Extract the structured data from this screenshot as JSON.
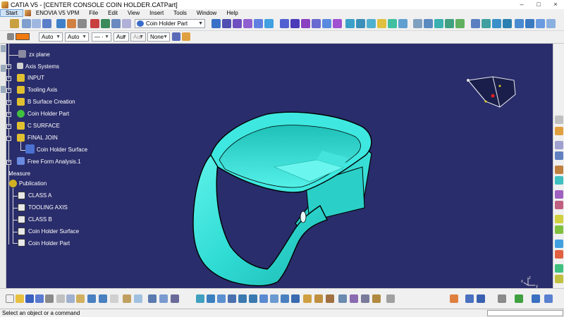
{
  "window": {
    "title": "CATIA V5 - [CENTER CONSOLE COIN HOLDER.CATPart]",
    "controls": [
      "–",
      "□",
      "×"
    ]
  },
  "menu": {
    "items": [
      "Start",
      "ENOVIA V5 VPM",
      "File",
      "Edit",
      "View",
      "Insert",
      "Tools",
      "Window",
      "Help"
    ]
  },
  "toolbar": {
    "current_part": "Coin Holder Part"
  },
  "format_toolbar": {
    "color": "#f07a10",
    "transparency": "Auto",
    "line_thickness": "Auto",
    "line_type": "— · — ·",
    "point_symbol": "Aut",
    "layer_disabled": "Aut",
    "layer": "None"
  },
  "spec_tree": {
    "items": [
      {
        "label": "zx plane",
        "icon": "plane-icon"
      },
      {
        "label": "Axis Systems",
        "icon": "folder-icon"
      },
      {
        "label": "INPUT",
        "icon": "geometrical-set-icon"
      },
      {
        "label": "Tooling Axis",
        "icon": "geometrical-set-icon"
      },
      {
        "label": "B Surface Creation",
        "icon": "geometrical-set-icon"
      },
      {
        "label": "Coin Holder Part",
        "icon": "body-icon"
      },
      {
        "label": "C SURFACE",
        "icon": "geometrical-set-icon"
      },
      {
        "label": "FINAL JOIN",
        "icon": "geometrical-set-icon"
      },
      {
        "label": "Coin Holder Surface",
        "icon": "surface-icon"
      },
      {
        "label": "Free Form Analysis.1",
        "icon": "analysis-icon"
      },
      {
        "label": "Measure",
        "icon": "none"
      },
      {
        "label": "Publication",
        "icon": "publication-icon"
      },
      {
        "label": "CLASS A",
        "icon": "publication-item-icon"
      },
      {
        "label": "TOOLING AXIS",
        "icon": "publication-item-icon"
      },
      {
        "label": "CLASS B",
        "icon": "publication-item-icon"
      },
      {
        "label": "Coin Holder Surface",
        "icon": "publication-item-icon"
      },
      {
        "label": "Coin Holder Part",
        "icon": "publication-item-icon"
      }
    ]
  },
  "model": {
    "color": "#33e8e0"
  },
  "status": {
    "message": "Select an object or a command"
  }
}
